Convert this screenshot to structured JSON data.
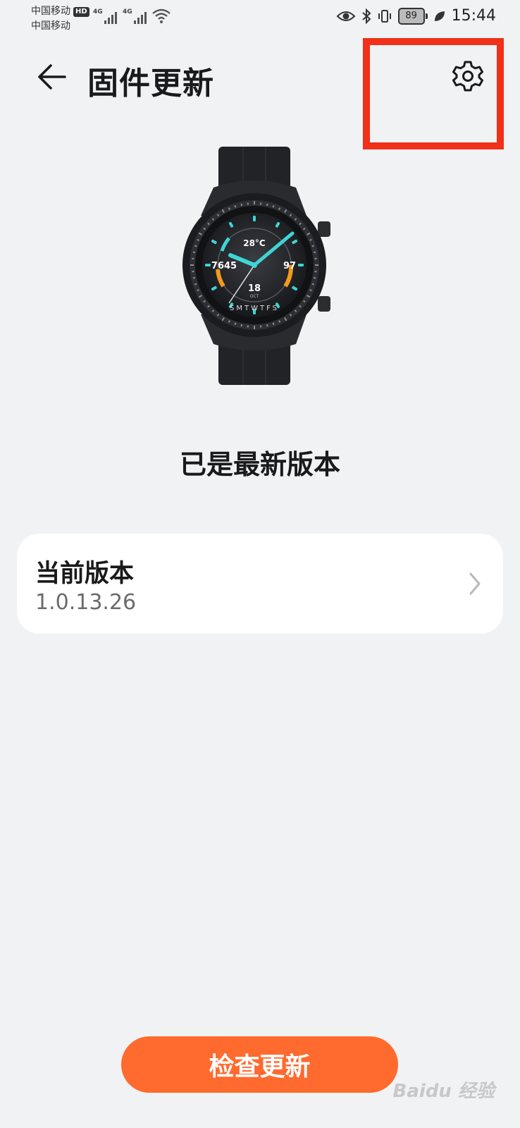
{
  "status_bar": {
    "carrier_1": "中国移动",
    "carrier_2": "中国移动",
    "hd_badge": "HD",
    "network_1": "4G",
    "network_2": "4G",
    "battery_level": "89",
    "time": "15:44"
  },
  "header": {
    "title": "固件更新"
  },
  "main": {
    "update_status": "已是最新版本",
    "version_card": {
      "label": "当前版本",
      "value": "1.0.13.26"
    },
    "check_button_label": "检查更新"
  },
  "watch_face": {
    "temperature": "28°C",
    "steps": "7645",
    "heart_rate": "97",
    "date_day": "18",
    "date_month": "OCT",
    "weekdays": "SMTWTFS"
  },
  "watermark": "Baidu 经验",
  "colors": {
    "accent": "#ff6a2e",
    "highlight_box": "#f03018",
    "background": "#f1f2f4",
    "watch_accent": "#3fd5d5"
  }
}
